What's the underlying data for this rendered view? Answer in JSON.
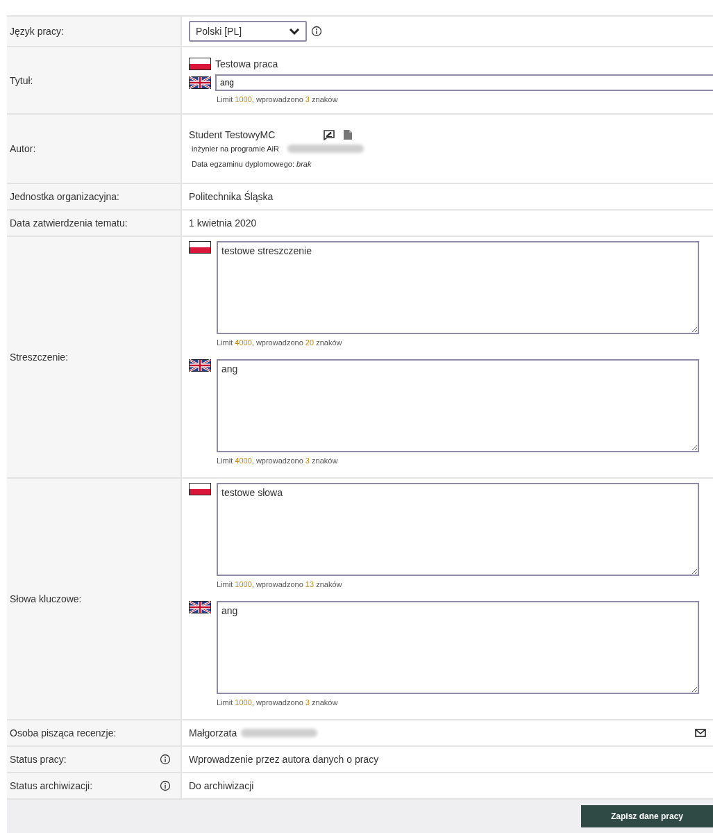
{
  "rows": [
    {
      "kind": "select",
      "label": "Język pracy:",
      "value": "Polski [PL]"
    },
    {
      "kind": "title",
      "label": "Tytuł:",
      "pl_text": "Testowa praca",
      "en_value": "ang",
      "counter": {
        "prefix": "Limit",
        "limit": "1000",
        "middle": ", wprowadzono",
        "count": "3",
        "suffix": "znaków"
      }
    },
    {
      "kind": "author",
      "label": "Autor:",
      "name": "Student TestowyMC",
      "programme": "inżynier na programie AiR",
      "exam": "Data egzaminu dyplomowego: *brak*"
    },
    {
      "kind": "text",
      "label": "Jednostka organizacyjna:",
      "value": "Politechnika Śląska"
    },
    {
      "kind": "text",
      "label": "Data zatwierdzenia tematu:",
      "value": "1 kwietnia 2020"
    },
    {
      "kind": "areas",
      "label": "Streszczenie:",
      "fields": [
        {
          "kind": "pl",
          "value": "testowe streszczenie",
          "counter": {
            "prefix": "Limit",
            "limit": "4000",
            "middle": ", wprowadzono",
            "count": "20",
            "suffix": "znaków"
          }
        },
        {
          "kind": "en",
          "value": "ang",
          "counter": {
            "prefix": "Limit",
            "limit": "4000",
            "middle": ", wprowadzono",
            "count": "3",
            "suffix": "znaków"
          }
        }
      ]
    },
    {
      "kind": "areas",
      "label": "Słowa kluczowe:",
      "fields": [
        {
          "kind": "pl",
          "value": "testowe słowa",
          "counter": {
            "prefix": "Limit",
            "limit": "1000",
            "middle": ", wprowadzono",
            "count": "13",
            "suffix": "znaków"
          }
        },
        {
          "kind": "en",
          "value": "ang",
          "counter": {
            "prefix": "Limit",
            "limit": "1000",
            "middle": ", wprowadzono",
            "count": "3",
            "suffix": "znaków"
          }
        }
      ]
    },
    {
      "kind": "reviewer",
      "label": "Osoba pisząca recenzje:",
      "value": "Małgorzata"
    },
    {
      "kind": "status",
      "label": "Status pracy:",
      "value": "Wprowadzenie przez autora danych o pracy"
    },
    {
      "kind": "status",
      "label": "Status archiwizacji:",
      "value": "Do archiwizacji"
    }
  ],
  "save_button": "Zapisz dane pracy"
}
